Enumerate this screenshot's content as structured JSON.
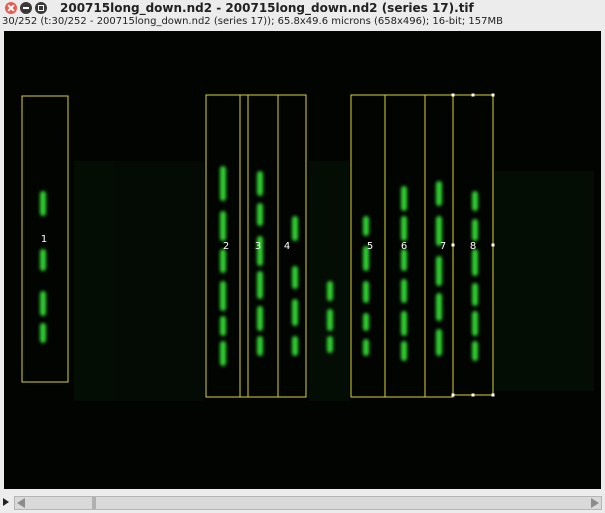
{
  "window": {
    "title": "200715long_down.nd2 - 200715long_down.nd2 (series 17).tif",
    "info": "30/252 (t:30/252 - 200715long_down.nd2 (series 17)); 65.8x49.6 microns (658x496); 16-bit; 157MB"
  },
  "rois": [
    {
      "label": "1"
    },
    {
      "label": "2"
    },
    {
      "label": "3"
    },
    {
      "label": "4"
    },
    {
      "label": "5"
    },
    {
      "label": "6"
    },
    {
      "label": "7"
    },
    {
      "label": "8"
    }
  ],
  "colors": {
    "roi": "#d9d32a",
    "signal": "#2fd12f",
    "selected_roi": "#ffffff"
  },
  "slider": {
    "frame": 30,
    "total": 252
  }
}
